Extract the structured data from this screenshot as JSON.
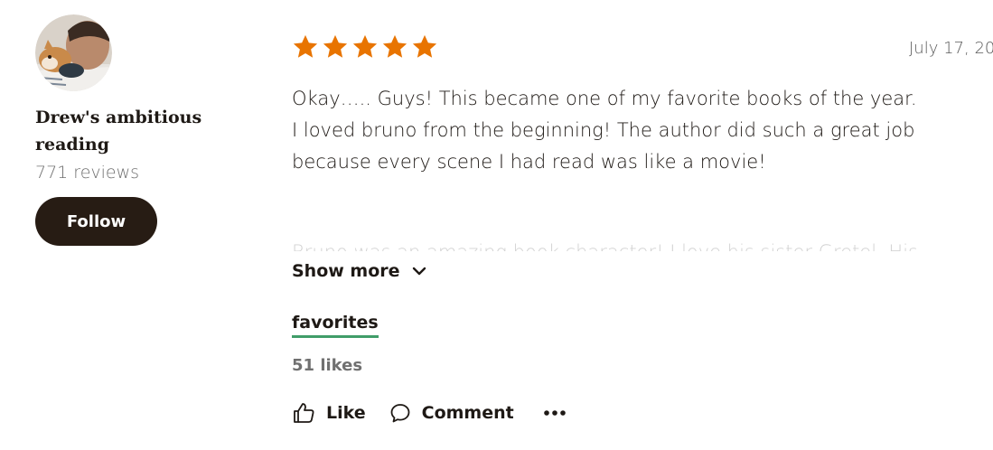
{
  "reviewer": {
    "name": "Drew's ambitious reading",
    "reviews": "771 reviews",
    "follow_label": "Follow"
  },
  "review": {
    "rating": 5,
    "max_rating": 5,
    "star_color": "#e87400",
    "date": "July 17, 20",
    "text_lines": [
      "Okay….. Guys! This became one of my favorite books of the year.",
      "I loved bruno from the beginning! The author did such a great job",
      "because every scene I had read was like a movie!"
    ],
    "faded_line": "Bruno was an amazing book character! I love his sister Gretel. His",
    "show_more_label": "Show more",
    "shelf_label": "favorites",
    "shelf_underline_color": "#409d69",
    "likes_count": "51 likes"
  },
  "actions": {
    "like_label": "Like",
    "comment_label": "Comment"
  },
  "icons": {
    "star": "star-icon",
    "chevron": "chevron-down-icon",
    "like": "thumbs-up-icon",
    "comment": "comment-bubble-icon",
    "more": "more-dots-icon"
  }
}
